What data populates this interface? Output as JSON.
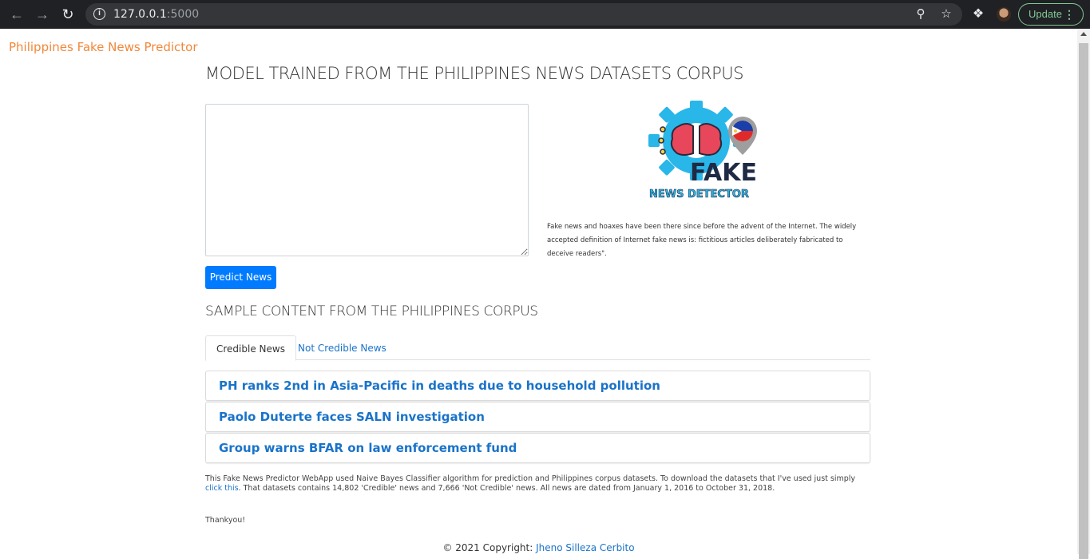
{
  "browser": {
    "url_host": "127.0.0.1",
    "url_port": ":5000",
    "update_label": "Update"
  },
  "brand": "Philippines Fake News Predictor",
  "main_heading": "MODEL TRAINED FROM THE PHILIPPINES NEWS DATASETS CORPUS",
  "input": {
    "value": ""
  },
  "predict_label": "Predict News",
  "logo": {
    "word": "FAKE",
    "tagline": "NEWS DETECTOR"
  },
  "description": "Fake news and hoaxes have been there since before the advent of the Internet. The widely accepted definition of Internet fake news is: fictitious articles deliberately fabricated to deceive readers\".",
  "sample_heading": "SAMPLE CONTENT FROM THE PHILIPPINES CORPUS",
  "tabs": [
    {
      "label": "Credible News",
      "active": true
    },
    {
      "label": "Not Credible News",
      "active": false
    }
  ],
  "news_items": [
    "PH ranks 2nd in Asia-Pacific in deaths due to household pollution",
    "Paolo Duterte faces SALN investigation",
    "Group warns BFAR on law enforcement fund"
  ],
  "info": {
    "before_link": "This Fake News Predictor WebApp used Naive Bayes Classifier algorithm for prediction and Philippines corpus datasets. To download the datasets that I've used just simply ",
    "link": "click this",
    "after_link": ". That datasets contains 14,802 'Credible' news and 7,666 'Not Credible' news. All news are dated from January 1, 2016 to October 31, 2018."
  },
  "thanks": "Thankyou!",
  "footer": {
    "prefix": "© 2021 Copyright: ",
    "author": "Jheno Silleza Cerbito"
  },
  "colors": {
    "brand": "#f0883a",
    "link": "#1a73c9",
    "button": "#007bff"
  }
}
